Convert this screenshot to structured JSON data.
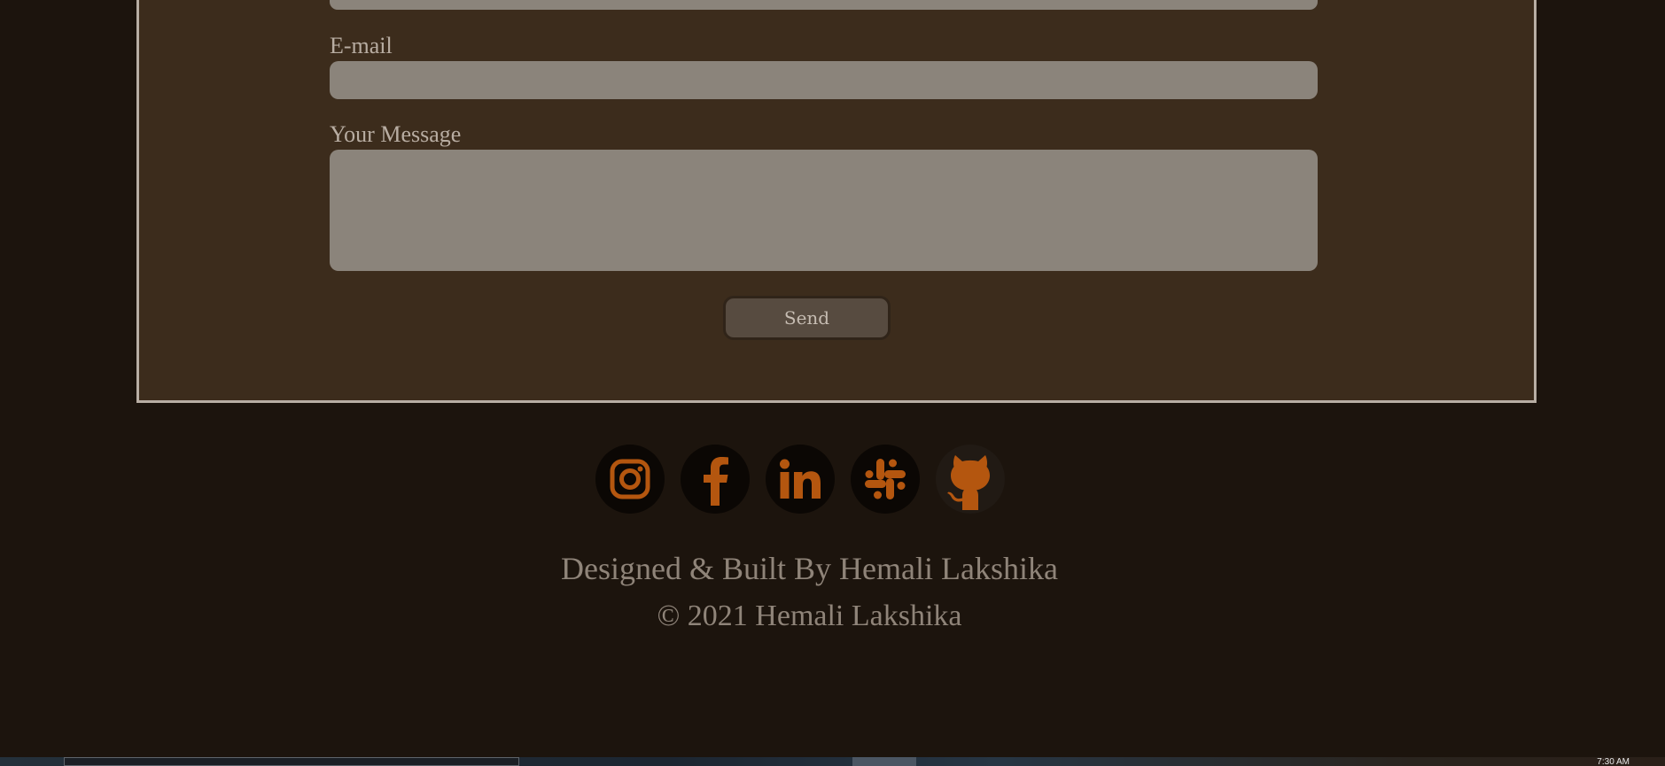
{
  "form": {
    "email_label": "E-mail",
    "message_label": "Your Message",
    "email_value": "",
    "message_value": "",
    "send_label": "Send"
  },
  "social": [
    {
      "name": "instagram-icon"
    },
    {
      "name": "facebook-icon"
    },
    {
      "name": "linkedin-icon"
    },
    {
      "name": "slack-icon"
    },
    {
      "name": "github-icon"
    }
  ],
  "footer": {
    "designed_by": "Designed & Built By Hemali Lakshika",
    "copyright": "© 2021 Hemali Lakshika"
  },
  "colors": {
    "background": "#1c140d",
    "panel": "#3c2c1c",
    "input": "#8b847b",
    "accent_icon": "#b4560f",
    "text_muted": "#8f8479"
  },
  "taskbar": {
    "clock": "7:30 AM"
  }
}
